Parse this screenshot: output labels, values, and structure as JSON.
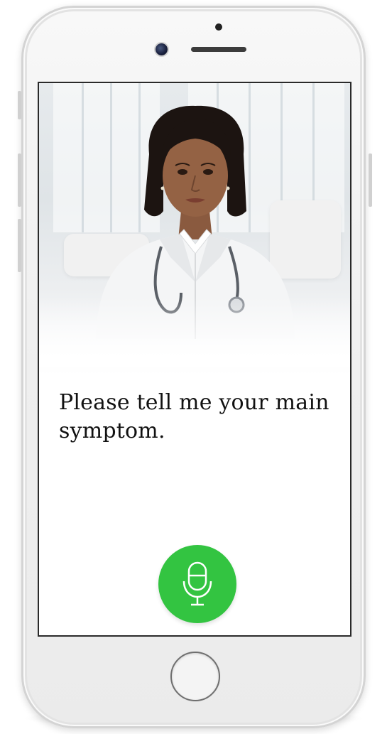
{
  "conversation": {
    "prompt": "Please tell me your main symptom."
  },
  "avatar": {
    "description_name": "doctor-avatar"
  },
  "mic_button": {
    "icon": "microphone-icon",
    "color": "#33c441"
  },
  "colors": {
    "accent": "#33c441",
    "text": "#111111",
    "screen_bg": "#ffffff"
  }
}
